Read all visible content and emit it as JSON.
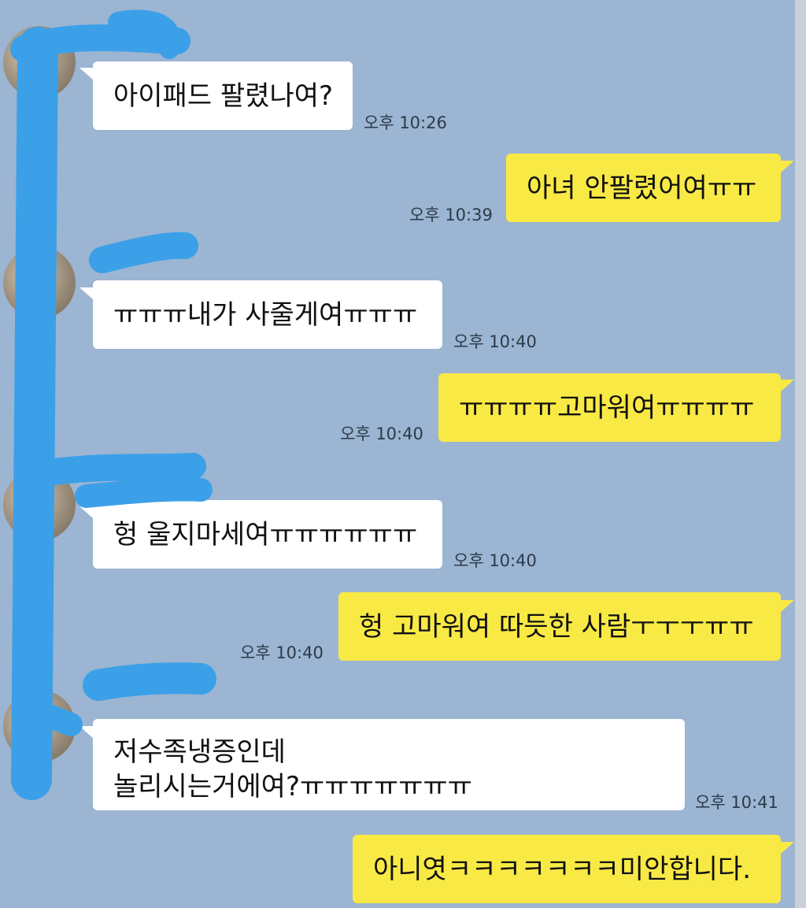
{
  "chat": {
    "messages": [
      {
        "side": "in",
        "text": "아이패드 팔렸나여?",
        "time": "오후 10:26"
      },
      {
        "side": "out",
        "text": "아녀 안팔렸어여ㅠㅠ",
        "time": "오후 10:39"
      },
      {
        "side": "in",
        "text": "ㅠㅠㅠ내가 사줄게여ㅠㅠㅠ",
        "time": "오후 10:40"
      },
      {
        "side": "out",
        "text": "ㅠㅠㅠㅠ고마워여ㅠㅠㅠㅠ",
        "time": "오후 10:40"
      },
      {
        "side": "in",
        "text": "헝 울지마세여ㅠㅠㅠㅠㅠㅠ",
        "time": "오후 10:40"
      },
      {
        "side": "out",
        "text": "헝 고마워여 따듯한 사람ㅜㅜㅜㅠㅠ",
        "time": "오후 10:40"
      },
      {
        "side": "in",
        "lines": [
          "저수족냉증인데",
          "놀리시는거에여?ㅠㅠㅠㅠㅠㅠㅠ"
        ],
        "time": "오후 10:41"
      },
      {
        "side": "out",
        "text": "아니엿ㅋㅋㅋㅋㅋㅋㅋ미안합니다."
      }
    ]
  },
  "colors": {
    "background": "#9bb5d2",
    "incoming_bubble": "#ffffff",
    "outgoing_bubble": "#f8e945",
    "redaction": "#3ba0e8"
  }
}
